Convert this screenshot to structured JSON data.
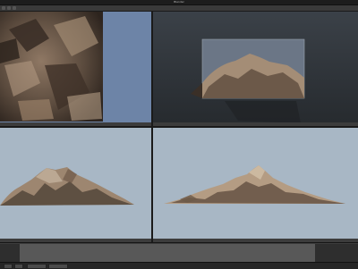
{
  "window": {
    "title": "Blender"
  },
  "header": {
    "file_path": ""
  },
  "timeline": {
    "frame_label": ""
  },
  "colors": {
    "viewport_bg_blue": "#6c82a6",
    "viewport_bg_dark": "#2f3439",
    "viewport_bg_sky": "#a9b8c6",
    "rock_light": "#b79a7c",
    "rock_dark": "#3b2f26"
  },
  "icons": [
    "file-menu-icon",
    "editor-type-icon",
    "play-icon",
    "record-icon"
  ]
}
